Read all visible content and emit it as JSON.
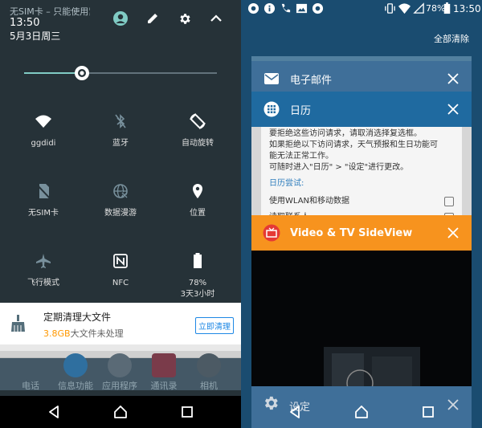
{
  "left": {
    "carrier": "无SIM卡 – 只能使用紧",
    "time": "13:50",
    "date": "5月3日周三",
    "brightness": 0.3,
    "tiles": [
      {
        "label": "ggdidi",
        "icon": "wifi-icon"
      },
      {
        "label": "蓝牙",
        "icon": "bluetooth-icon"
      },
      {
        "label": "自动旋转",
        "icon": "rotate-icon"
      },
      {
        "label": "无SIM卡",
        "icon": "no-sim-icon"
      },
      {
        "label": "数据漫游",
        "icon": "globe-icon"
      },
      {
        "label": "位置",
        "icon": "location-icon"
      },
      {
        "label": "飞行模式",
        "icon": "airplane-icon"
      },
      {
        "label": "NFC",
        "icon": "nfc-icon"
      },
      {
        "label": "78%",
        "label2": "3天3小时",
        "icon": "battery-icon"
      }
    ],
    "notification": {
      "title": "定期清理大文件",
      "size": "3.8GB",
      "desc": "大文件未处理",
      "button": "立即清理"
    },
    "dock": [
      "电话",
      "信息功能",
      "应用程序",
      "通讯录",
      "相机"
    ]
  },
  "right": {
    "battery": "78%",
    "time": "13:50",
    "clear_all": "全部清除",
    "cards": {
      "email": "电子邮件",
      "calendar": "日历",
      "sideview": "Video & TV SideView",
      "settings": "设定"
    },
    "calendar_body": {
      "line1": "要拒绝这些访问请求，请取消选择复选框。",
      "line2": "如果拒绝以下访问请求，天气预报和生日功能可",
      "line3": "能无法正常工作。",
      "line4": "可随时进入\"日历\" > \"设定\"进行更改。",
      "section": "日历尝试:",
      "option1": "使用WLAN和移动数据",
      "option2": "读取联系人"
    }
  },
  "colors": {
    "shade_bg": "#263238",
    "accent_teal": "#80cbc4",
    "recents_bg": "#1a4c70",
    "email_card": "#3f6f99",
    "calendar_card": "#1f6aa0",
    "sideview_card": "#f7931e"
  }
}
